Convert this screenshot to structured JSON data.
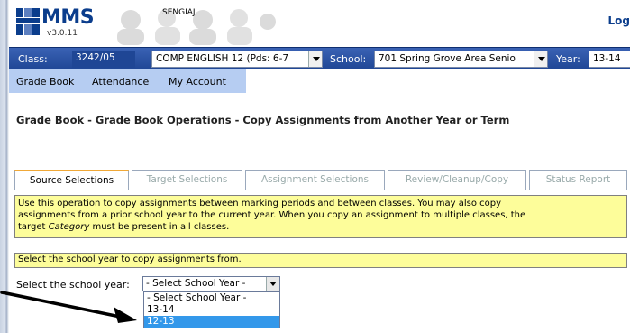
{
  "header": {
    "app_name": "MMS",
    "version": "v3.0.11",
    "user": "SENGIAJ",
    "logout_label": "Log"
  },
  "class_bar": {
    "class_label": "Class:",
    "class_value": "3242/05",
    "course_value": "COMP ENGLISH 12 (Pds: 6-7",
    "school_label": "School:",
    "school_value": "701 Spring Grove Area Senio",
    "year_label": "Year:",
    "year_value": "13-14"
  },
  "menu": {
    "items": [
      "Grade Book",
      "Attendance",
      "My Account"
    ]
  },
  "page_title": "Grade Book - Grade Book Operations - Copy Assignments from Another Year or Term",
  "tabs": [
    {
      "label": "Source Selections",
      "active": true
    },
    {
      "label": "Target Selections",
      "active": false
    },
    {
      "label": "Assignment Selections",
      "active": false
    },
    {
      "label": "Review/Cleanup/Copy",
      "active": false
    },
    {
      "label": "Status Report",
      "active": false
    }
  ],
  "info": {
    "line1": "Use this operation to copy assignments between marking periods and between classes. You may also copy",
    "line2": "assignments from a prior school year to the current year. When you copy an assignment to multiple classes, the",
    "line3_pre": "target ",
    "line3_italic": "Category",
    "line3_post": " must be present in all classes."
  },
  "instruction": "Select the school year to copy assignments from.",
  "school_year": {
    "label": "Select the school year:",
    "selected": "- Select School Year -",
    "options": [
      "- Select School Year -",
      "13-14",
      "12-13"
    ],
    "highlighted_option": "12-13"
  },
  "colors": {
    "brand_blue": "#0b3d8c",
    "selection_bar": "#1f4695",
    "menu_bar": "#b6cdf2",
    "info_yellow": "#fdfd9a",
    "active_tab_accent": "#f0a838",
    "highlight": "#3398ea"
  }
}
